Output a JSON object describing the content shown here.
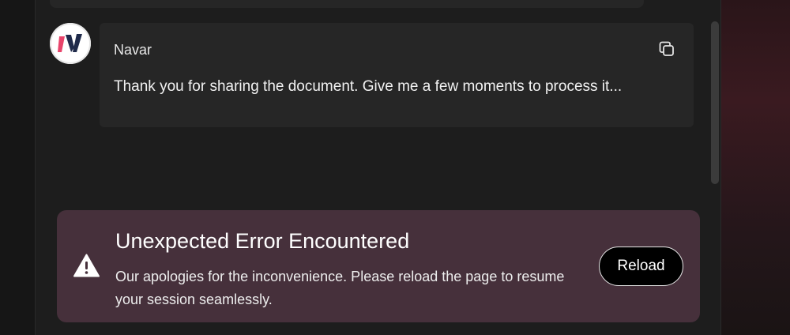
{
  "message": {
    "author": "Navar",
    "text": "Thank you for sharing the document. Give me a few moments to process it...",
    "avatar_icon": "navar-logo-icon",
    "copy_icon": "copy-icon"
  },
  "error": {
    "icon": "warning-icon",
    "title": "Unexpected Error Encountered",
    "body": "Our apologies for the inconvenience. Please reload the page to resume your session seamlessly.",
    "reload_label": "Reload"
  },
  "colors": {
    "banner_bg": "#46303b",
    "logo_pink": "#e8446b",
    "logo_navy": "#1f2a4a"
  }
}
